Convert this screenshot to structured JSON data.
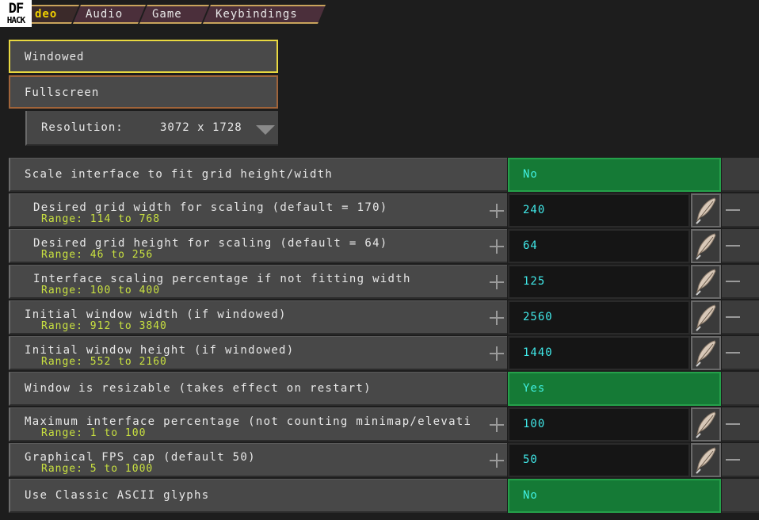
{
  "logo": {
    "line1": "DF",
    "line2": "HACK"
  },
  "tabs": [
    {
      "label": "Video",
      "shown": "deo"
    },
    {
      "label": "Audio"
    },
    {
      "label": "Game"
    },
    {
      "label": "Keybindings"
    }
  ],
  "modes": {
    "windowed": "Windowed",
    "fullscreen": "Fullscreen"
  },
  "resolution": {
    "label": "Resolution:",
    "value": "3072 x 1728"
  },
  "settings": [
    {
      "title": "Scale interface to fit grid height/width",
      "value": "No"
    },
    {
      "title": "Desired grid width for scaling (default = 170)",
      "range": "Range: 114 to 768",
      "value": "240"
    },
    {
      "title": "Desired grid height for scaling (default = 64)",
      "range": "Range: 46 to 256",
      "value": "64"
    },
    {
      "title": "Interface scaling percentage if not fitting width",
      "range": "Range: 100 to 400",
      "value": "125"
    },
    {
      "title": "Initial window width (if windowed)",
      "range": "Range: 912 to 3840",
      "value": "2560"
    },
    {
      "title": "Initial window height (if windowed)",
      "range": "Range: 552 to 2160",
      "value": "1440"
    },
    {
      "title": "Window is resizable (takes effect on restart)",
      "value": "Yes"
    },
    {
      "title": "Maximum interface percentage (not counting minimap/elevati",
      "range": "Range: 1 to 100",
      "value": "100"
    },
    {
      "title": "Graphical FPS cap (default 50)",
      "range": "Range: 5 to 1000",
      "value": "50"
    },
    {
      "title": "Use Classic ASCII glyphs",
      "value": "No"
    }
  ],
  "colors": {
    "background": "#1d1d1d",
    "toggle_on_bg": "#157a36",
    "value_text": "#40e8e8",
    "range_text": "#c8e040",
    "active_tab_text": "#f0d000",
    "selected_border": "#e8d840"
  },
  "icons": {
    "edit": "quill-pen-icon",
    "increment": "plus-icon",
    "decrement": "minus-icon",
    "dropdown": "triangle-down-icon"
  }
}
